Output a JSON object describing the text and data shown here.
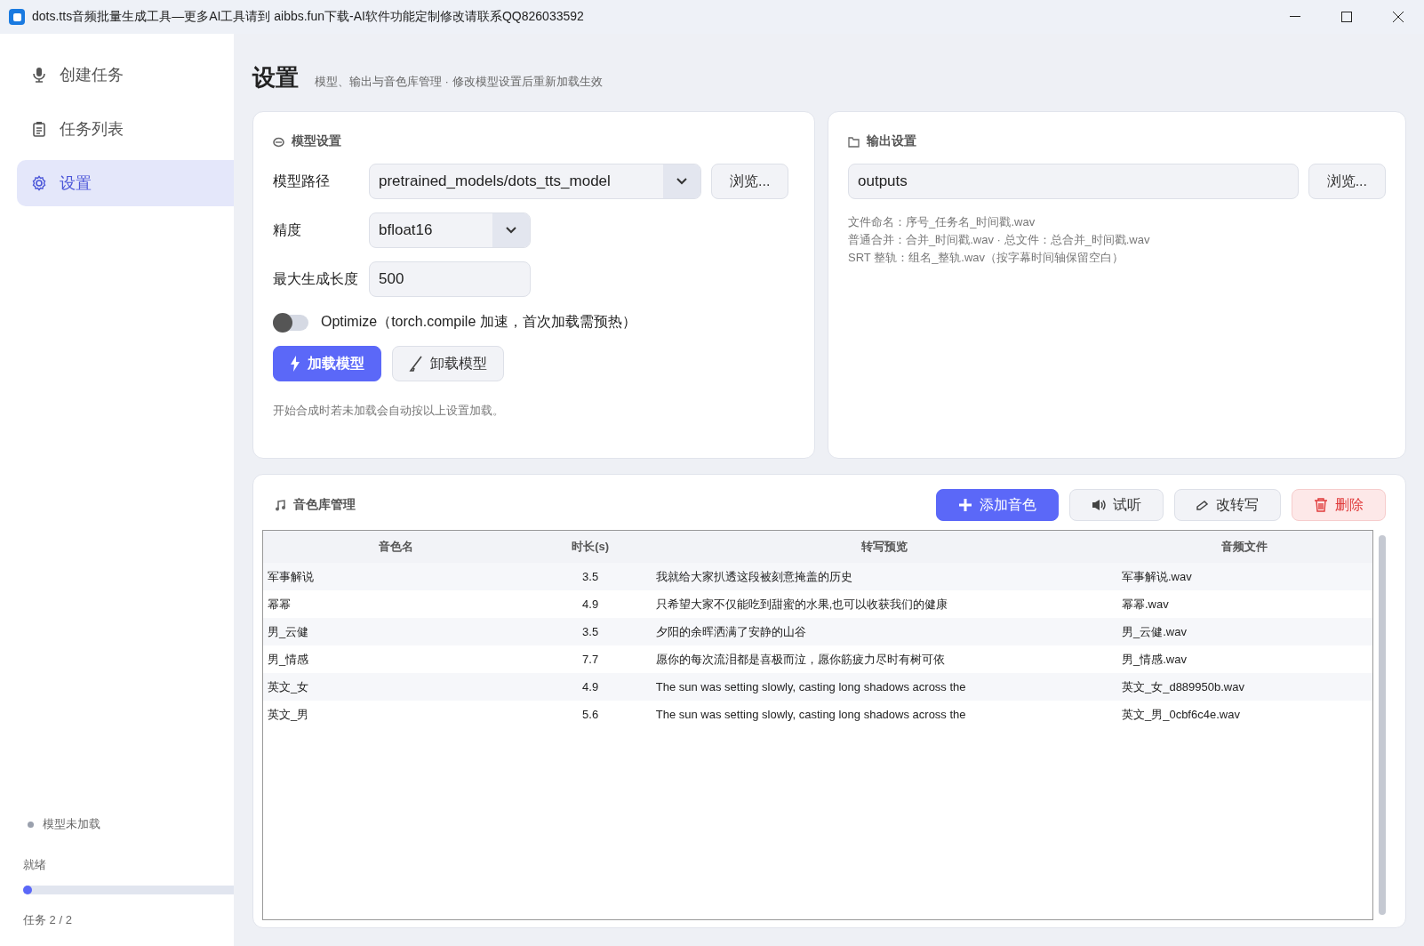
{
  "window": {
    "title": "dots.tts音频批量生成工具—更多AI工具请到 aibbs.fun下载-AI软件功能定制修改请联系QQ826033592"
  },
  "sidebar": {
    "items": [
      {
        "label": "创建任务",
        "selected": false
      },
      {
        "label": "任务列表",
        "selected": false
      },
      {
        "label": "设置",
        "selected": true
      }
    ],
    "model_status": {
      "label": "模型未加载",
      "loaded": false
    },
    "status": "就绪",
    "progress": {
      "level": 0
    },
    "task_count": "任务 2 / 2"
  },
  "page": {
    "title": "设置",
    "subtitle": "模型、输出与音色库管理 · 修改模型设置后重新加载生效"
  },
  "model_settings": {
    "title": "模型设置",
    "model_path": {
      "label": "模型路径",
      "value": "pretrained_models/dots_tts_model",
      "browse": "浏览..."
    },
    "precision": {
      "label": "精度",
      "value": "bfloat16"
    },
    "max_length": {
      "label": "最大生成长度",
      "value": "500"
    },
    "optimize": {
      "label": "Optimize（torch.compile 加速，首次加载需预热）",
      "on": false
    },
    "load_button": "加载模型",
    "unload_button": "卸载模型",
    "hint": "开始合成时若未加载会自动按以上设置加载。"
  },
  "output_settings": {
    "title": "输出设置",
    "path": "outputs",
    "browse": "浏览...",
    "notes": [
      "文件命名：序号_任务名_时间戳.wav",
      "普通合并：合并_时间戳.wav · 总文件：总合并_时间戳.wav",
      "SRT 整轨：组名_整轨.wav（按字幕时间轴保留空白）"
    ]
  },
  "voice_library": {
    "title": "音色库管理",
    "buttons": [
      {
        "label": "添加音色",
        "kind": "primary"
      },
      {
        "label": "试听",
        "kind": "play"
      },
      {
        "label": "改转写",
        "kind": "edit"
      },
      {
        "label": "删除",
        "kind": "danger"
      }
    ],
    "table": {
      "columns": [
        "音色名",
        "时长(s)",
        "转写预览",
        "音频文件"
      ],
      "rows": [
        [
          "军事解说",
          "3.5",
          "我就给大家扒透这段被刻意掩盖的历史",
          "军事解说.wav"
        ],
        [
          "幂幂",
          "4.9",
          "只希望大家不仅能吃到甜蜜的水果,也可以收获我们的健康",
          "幂幂.wav"
        ],
        [
          "男_云健",
          "3.5",
          "夕阳的余晖洒满了安静的山谷",
          "男_云健.wav"
        ],
        [
          "男_情感",
          "7.7",
          "愿你的每次流泪都是喜极而泣，愿你筋疲力尽时有树可依",
          "男_情感.wav"
        ],
        [
          "英文_女",
          "4.9",
          "The sun was setting slowly, casting long shadows across the",
          "英文_女_d889950b.wav"
        ],
        [
          "英文_男",
          "5.6",
          "The sun was setting slowly, casting long shadows across the",
          "英文_男_0cbf6c4e.wav"
        ]
      ]
    }
  }
}
